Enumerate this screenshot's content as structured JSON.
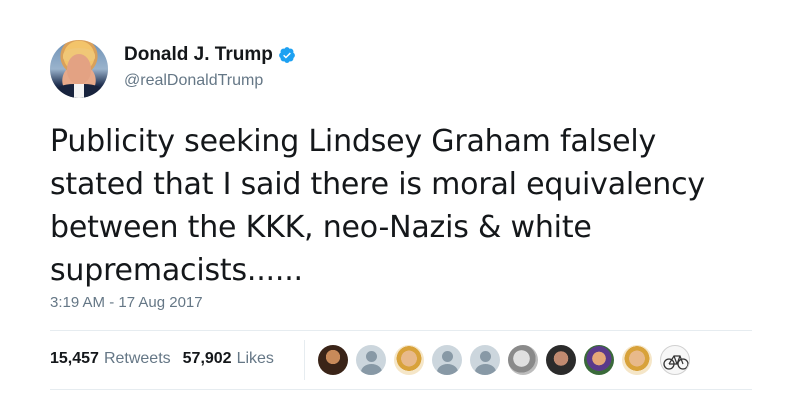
{
  "user": {
    "display_name": "Donald J. Trump",
    "handle": "@realDonaldTrump",
    "verified": true,
    "verified_icon": "verified-badge-icon"
  },
  "tweet": {
    "text": "Publicity seeking Lindsey Graham falsely stated that I said there is moral equivalency between the KKK, neo-Nazis & white supremacists......",
    "timestamp": "3:19 AM - 17 Aug 2017"
  },
  "stats": {
    "retweets_count": "15,457",
    "retweets_label": "Retweets",
    "likes_count": "57,902",
    "likes_label": "Likes"
  },
  "liked_by_avatars": [
    {
      "kind": "photo"
    },
    {
      "kind": "default"
    },
    {
      "kind": "photo"
    },
    {
      "kind": "default"
    },
    {
      "kind": "default"
    },
    {
      "kind": "photo"
    },
    {
      "kind": "photo"
    },
    {
      "kind": "photo"
    },
    {
      "kind": "photo"
    },
    {
      "kind": "photo"
    }
  ],
  "colors": {
    "text": "#14171a",
    "secondary": "#657786",
    "verified_blue": "#1da1f2",
    "divider": "#e6ecf0"
  }
}
